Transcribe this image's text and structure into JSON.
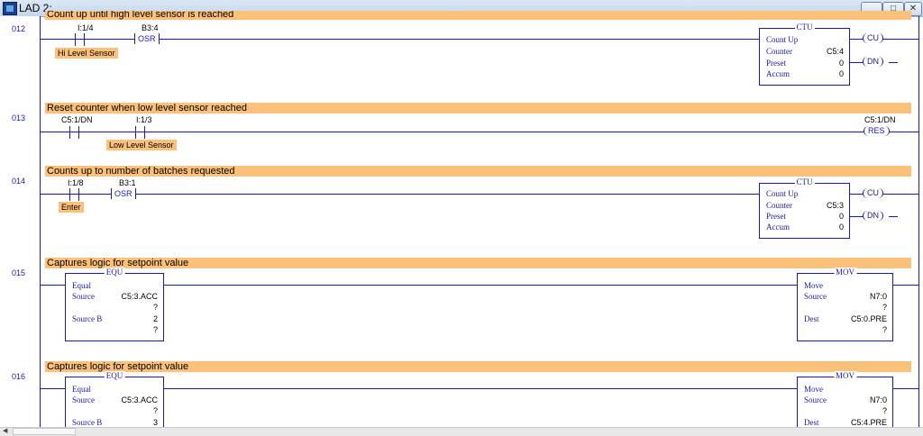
{
  "window": {
    "title": "LAD 2:",
    "min_label": "▁",
    "max_label": "□",
    "close_label": "✕"
  },
  "rungs": {
    "r012": {
      "number": "012",
      "comment": "Count up until high level sensor is reached",
      "contact_addr": "I:1/4",
      "contact_desc": "Hi Level Sensor",
      "osr_addr": "B3:4",
      "osr_label": "OSR",
      "block_title": "CTU",
      "block_name": "Count Up",
      "counter_label": "Counter",
      "counter_val": "C5:4",
      "preset_label": "Preset",
      "preset_val": "0",
      "accum_label": "Accum",
      "accum_val": "0",
      "coil1": "CU",
      "coil2": "DN"
    },
    "r013": {
      "number": "013",
      "comment": "Reset counter when low level sensor reached",
      "contact1_addr": "C5:1/DN",
      "contact2_addr": "I:1/3",
      "contact2_desc": "Low Level Sensor",
      "coil_addr": "C5:1/DN",
      "coil": "RES"
    },
    "r014": {
      "number": "014",
      "comment": "Counts up to number of batches requested",
      "contact_addr": "I:1/8",
      "contact_desc": "Enter",
      "osr_addr": "B3:1",
      "osr_label": "OSR",
      "block_title": "CTU",
      "block_name": "Count Up",
      "counter_label": "Counter",
      "counter_val": "C5:3",
      "preset_label": "Preset",
      "preset_val": "0",
      "accum_label": "Accum",
      "accum_val": "0",
      "coil1": "CU",
      "coil2": "DN"
    },
    "r015": {
      "number": "015",
      "comment": "Captures logic for setpoint value",
      "equ_title": "EQU",
      "equ_name": "Equal",
      "source_label": "Source",
      "source_val": "C5:3.ACC",
      "source_q": "?",
      "sourceb_label": "Source B",
      "sourceb_val": "2",
      "sourceb_q": "?",
      "mov_title": "MOV",
      "mov_name": "Move",
      "mov_source_label": "Source",
      "mov_source_val": "N7:0",
      "mov_source_q": "?",
      "dest_label": "Dest",
      "dest_val": "C5:0.PRE",
      "dest_q": "?"
    },
    "r016": {
      "number": "016",
      "comment": "Captures logic for setpoint value",
      "equ_title": "EQU",
      "equ_name": "Equal",
      "source_label": "Source",
      "source_val": "C5:3.ACC",
      "source_q": "?",
      "sourceb_label": "Source B",
      "sourceb_val": "3",
      "mov_title": "MOV",
      "mov_name": "Move",
      "mov_source_label": "Source",
      "mov_source_val": "N7:0",
      "mov_source_q": "?",
      "dest_label": "Dest",
      "dest_val": "C5:4.PRE"
    }
  },
  "colors": {
    "wire": "#1a1aa8",
    "comment_bg": "#fbc17b"
  },
  "scrollbar": {
    "left_arrow": "◀"
  }
}
